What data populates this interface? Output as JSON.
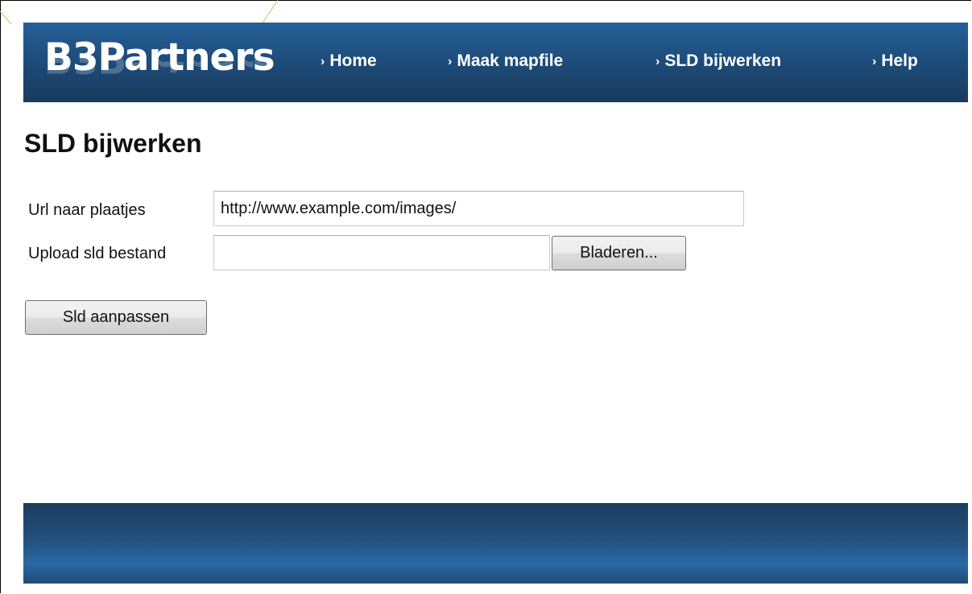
{
  "header": {
    "logo_text": "B3Partners",
    "nav": [
      {
        "label": "Home"
      },
      {
        "label": "Maak mapfile"
      },
      {
        "label": "SLD bijwerken"
      },
      {
        "label": "Help"
      }
    ],
    "nav_chevron": "›"
  },
  "page": {
    "title": "SLD bijwerken"
  },
  "form": {
    "url_label": "Url naar plaatjes",
    "url_value": "http://www.example.com/images/",
    "upload_label": "Upload sld bestand",
    "upload_value": "",
    "browse_label": "Bladeren...",
    "submit_label": "Sld aanpassen"
  },
  "colors": {
    "header_blue": "#1e4d7c",
    "footer_blue": "#22507e"
  }
}
